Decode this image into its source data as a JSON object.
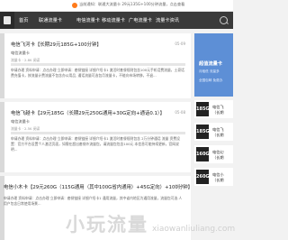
{
  "topbar": {
    "hint": "当前通知：联通大流量卡 29元135G+100分钟流量，点击查看"
  },
  "nav": {
    "items": [
      "首页",
      "联通流量卡",
      "电信流量卡",
      "移动流量卡",
      "广电流量卡",
      "流量卡资讯"
    ]
  },
  "articles": [
    {
      "title": "电信飞河卡【长期29元185G+100分钟】",
      "date": "05-09",
      "sub": "电信流量卡",
      "meta": "流量卡 · 2.8K 阅读",
      "desc": "申请办理 资料申请：点击办理 立即申请：套餐链接 详细介绍卡1 激活时套餐规则包含100元手机话费流量，土豪话费充值卡，按流量计费流量不包含办公用品, 通话流量可选包月流量卡，不能向市场转移，不退..."
    },
    {
      "title": "电信飞越卡【29元185G（长期29元250G通用+30G定向+通话0.1）】",
      "date": "05-08",
      "sub": "电信流量卡",
      "meta": "流量卡 · 2.5K 阅读",
      "desc": "申请办理 资料申请：点击办理 立即申请：套餐链接 详细介绍卡1 激活时套餐规则包含 2万分钟通话 流量 资费设置：官方平台设置个人激活页面，如需在超出套餐外流量包，请流量包包含100元 本信息可能持续更新，官网说明..."
    },
    {
      "title": "电信小木卡【29元260G（115G通用（其中100G省内通用）+45G定向）+100分钟】",
      "date": "05-06",
      "sub": "",
      "meta": "",
      "desc": "申请办理 资料申请：点击办理 立即申请：套餐链接 详细介绍卡1 通用流量，其中省内地区为通用流量，流量包可选 人用户包含日常使用场景..."
    }
  ],
  "sidebar": {
    "promo": {
      "title": "超值流量卡",
      "line1": "月租低 流量多",
      "line2": "全国包邮 免费办"
    },
    "items": [
      {
        "badge": "185G",
        "line1": "电信飞",
        "line2": "（长期"
      },
      {
        "badge": "185G",
        "line1": "电信飞",
        "line2": "（长期"
      },
      {
        "badge": "160G",
        "line1": "电信幻",
        "line2": "（长期"
      },
      {
        "badge": "260G",
        "line1": "电信小",
        "line2": "（长期"
      }
    ]
  },
  "watermark": {
    "brand": "小玩流量",
    "url": "xiaowanliuliang.com"
  }
}
